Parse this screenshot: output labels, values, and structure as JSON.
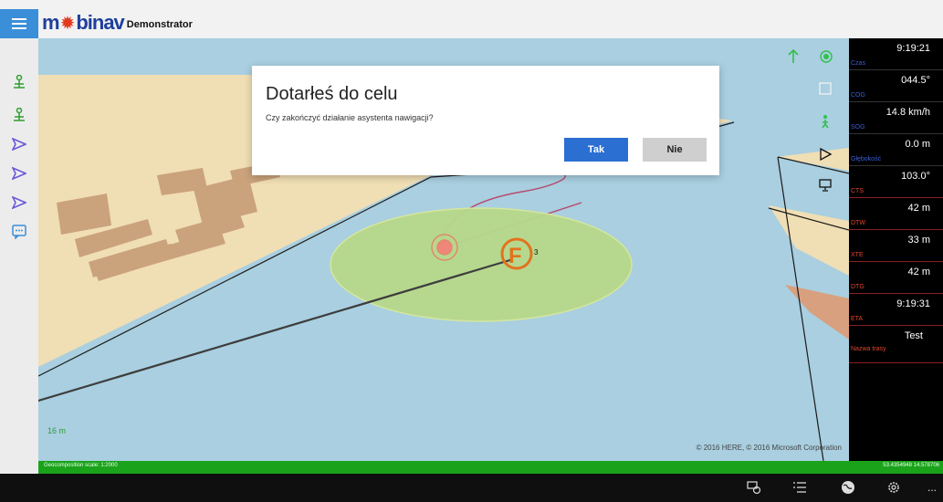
{
  "header": {
    "logo_prefix": "m",
    "logo_suffix": "binav",
    "app_name": "Demonstrator"
  },
  "left_rail": [
    {
      "name": "anchor-person-icon-1"
    },
    {
      "name": "anchor-person-icon-2"
    },
    {
      "name": "play-arrow-icon-1"
    },
    {
      "name": "play-arrow-icon-2"
    },
    {
      "name": "play-arrow-icon-3"
    },
    {
      "name": "message-icon"
    }
  ],
  "dialog": {
    "title": "Dotarłeś do celu",
    "message": "Czy zakończyć działanie asystenta nawigacji?",
    "yes_label": "Tak",
    "no_label": "Nie"
  },
  "map": {
    "scale_text": "16 m",
    "copyright": "© 2016 HERE, © 2016 Microsoft Corporation",
    "waypoint_label": "3",
    "colors": {
      "water": "#a9cfe0",
      "land": "#f0deb4",
      "buildings": "#caa27c",
      "zone": "#b7d98a",
      "track": "#b74b6e",
      "accent": "#e2731e"
    }
  },
  "panel": {
    "rows": [
      {
        "label": "Czas",
        "value": "9:19:21",
        "label_color": "#3a5fd9"
      },
      {
        "label": "COG",
        "value": "044.5°",
        "label_color": "#3a5fd9"
      },
      {
        "label": "SOG",
        "value": "14.8 km/h",
        "label_color": "#3a5fd9"
      },
      {
        "label": "Głębokość",
        "value": "0.0 m",
        "label_color": "#3a5fd9"
      },
      {
        "label": "CTS",
        "value": "103.0°",
        "label_color": "#e2462d"
      },
      {
        "label": "DTW",
        "value": "42 m",
        "label_color": "#e2462d"
      },
      {
        "label": "XTE",
        "value": "33 m",
        "label_color": "#e2462d"
      },
      {
        "label": "DTG",
        "value": "42 m",
        "label_color": "#e2462d"
      },
      {
        "label": "ETA",
        "value": "9:19:31",
        "label_color": "#e2462d"
      },
      {
        "label": "Nazwa trasy",
        "value": "Test",
        "label_color": "#e2462d"
      }
    ]
  },
  "status": {
    "geocomposition": "Geocomposition scale: 1:2000",
    "coords": "53.4354948 14.578706"
  },
  "bottom_bar": [
    {
      "name": "route-icon"
    },
    {
      "name": "list-icon"
    },
    {
      "name": "globe-icon"
    },
    {
      "name": "settings-gear-icon"
    },
    {
      "name": "more-icon",
      "label": "..."
    }
  ]
}
